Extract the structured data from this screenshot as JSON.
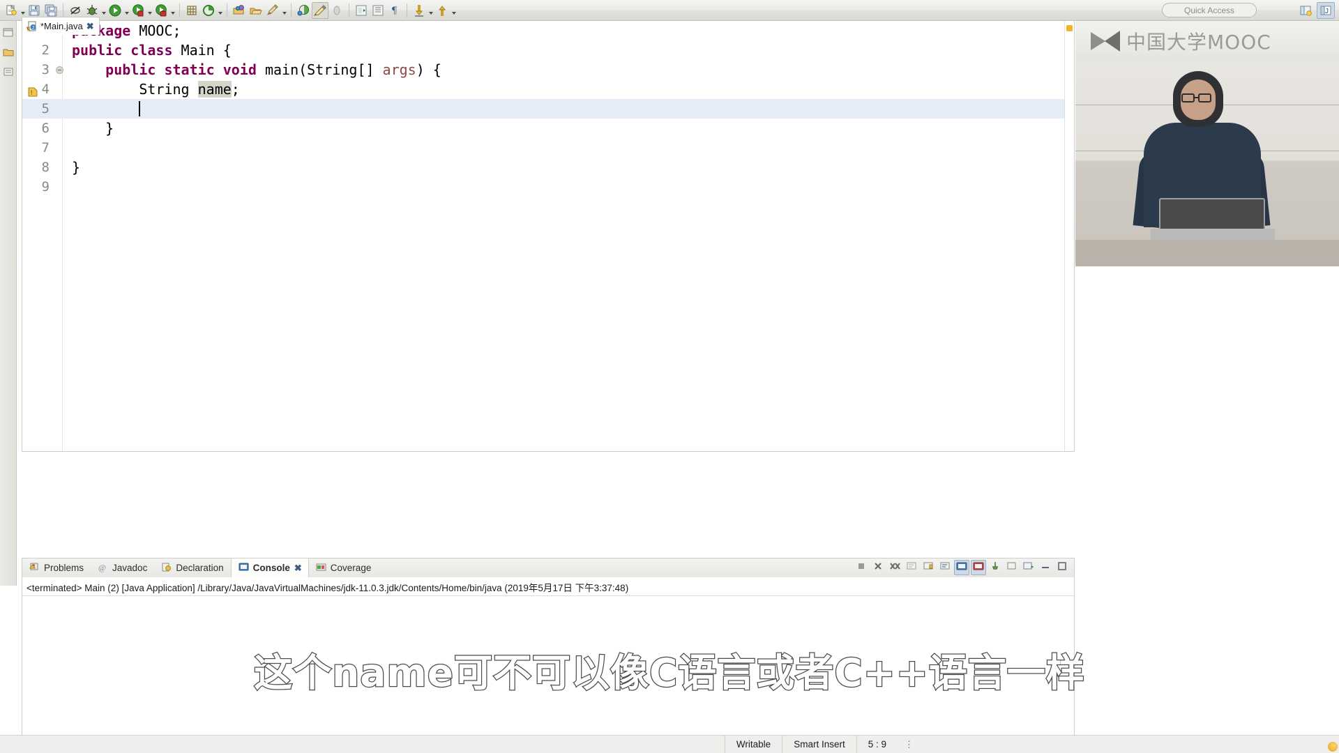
{
  "window": {
    "quick_access_label": "Quick Access"
  },
  "toolbar": {
    "buttons": [
      {
        "name": "new-wizard-button",
        "icon": "new-file-icon",
        "dropdown": true
      },
      {
        "name": "save-button",
        "icon": "save-icon",
        "dropdown": false
      },
      {
        "name": "save-all-button",
        "icon": "save-all-icon",
        "dropdown": false
      },
      {
        "name": "toggle-breakpoint-button",
        "icon": "skip-breakpoints-icon",
        "dropdown": false
      },
      {
        "name": "debug-button",
        "icon": "debug-bug-icon",
        "dropdown": true
      },
      {
        "name": "run-button",
        "icon": "run-play-icon",
        "dropdown": true
      },
      {
        "name": "coverage-button",
        "icon": "coverage-icon",
        "dropdown": true
      },
      {
        "name": "run-external-tools-button",
        "icon": "external-tools-icon",
        "dropdown": true
      },
      {
        "name": "new-java-project-button",
        "icon": "new-project-icon",
        "dropdown": false
      },
      {
        "name": "new-package-button",
        "icon": "new-package-icon",
        "dropdown": true
      },
      {
        "name": "open-type-button",
        "icon": "open-type-icon",
        "dropdown": false
      },
      {
        "name": "open-task-button",
        "icon": "open-folder-icon",
        "dropdown": false
      },
      {
        "name": "search-button",
        "icon": "pencil-search-icon",
        "dropdown": true
      },
      {
        "name": "git-button",
        "icon": "git-icon",
        "dropdown": false
      },
      {
        "name": "annotate-button",
        "icon": "highlighter-icon",
        "dropdown": false
      },
      {
        "name": "toggle-mark-button",
        "icon": "mark-occurrences-icon",
        "dropdown": false
      },
      {
        "name": "next-annotation-button",
        "icon": "next-annotation-icon",
        "dropdown": false
      },
      {
        "name": "previous-annotation-button",
        "icon": "previous-annotation-icon",
        "dropdown": false
      },
      {
        "name": "pilcrow-button",
        "icon": "pilcrow-icon",
        "dropdown": false
      },
      {
        "name": "next-edit-button",
        "icon": "down-arrow-icon",
        "dropdown": true
      },
      {
        "name": "previous-edit-button",
        "icon": "up-arrow-icon",
        "dropdown": true
      }
    ],
    "perspective_buttons": [
      {
        "name": "open-perspective-button",
        "icon": "open-perspective-icon"
      },
      {
        "name": "java-perspective-button",
        "icon": "java-perspective-icon"
      }
    ]
  },
  "editor": {
    "tab": {
      "label": "*Main.java",
      "icon": "java-file-icon",
      "close_icon": "close-icon"
    },
    "cursor_line": 5,
    "lines": [
      {
        "num": "1",
        "fold": false,
        "warn": false,
        "segments": [
          {
            "t": "package",
            "c": "kw"
          },
          {
            "t": " MOOC;",
            "c": ""
          }
        ]
      },
      {
        "num": "2",
        "fold": false,
        "warn": false,
        "segments": [
          {
            "t": "public class",
            "c": "kw"
          },
          {
            "t": " Main {",
            "c": ""
          }
        ]
      },
      {
        "num": "3",
        "fold": true,
        "warn": false,
        "segments": [
          {
            "t": "    ",
            "c": ""
          },
          {
            "t": "public static void",
            "c": "kw"
          },
          {
            "t": " main(String[] ",
            "c": ""
          },
          {
            "t": "args",
            "c": "param"
          },
          {
            "t": ") {",
            "c": ""
          }
        ]
      },
      {
        "num": "4",
        "fold": false,
        "warn": true,
        "segments": [
          {
            "t": "        String ",
            "c": ""
          },
          {
            "t": "name",
            "c": "occ"
          },
          {
            "t": ";",
            "c": ""
          }
        ]
      },
      {
        "num": "5",
        "fold": false,
        "warn": false,
        "caret": true,
        "segments": [
          {
            "t": "        ",
            "c": ""
          }
        ]
      },
      {
        "num": "6",
        "fold": false,
        "warn": false,
        "segments": [
          {
            "t": "    }",
            "c": ""
          }
        ]
      },
      {
        "num": "7",
        "fold": false,
        "warn": false,
        "segments": [
          {
            "t": "",
            "c": ""
          }
        ]
      },
      {
        "num": "8",
        "fold": false,
        "warn": false,
        "segments": [
          {
            "t": "}",
            "c": ""
          }
        ]
      },
      {
        "num": "9",
        "fold": false,
        "warn": false,
        "segments": [
          {
            "t": "",
            "c": ""
          }
        ]
      }
    ]
  },
  "video_overlay": {
    "logo_text": "中国大学MOOC",
    "logo_icon": "mooc-book-icon"
  },
  "bottom_panel": {
    "tabs": [
      {
        "label": "Problems",
        "icon": "problems-icon",
        "active": false,
        "closable": false
      },
      {
        "label": "Javadoc",
        "icon": "javadoc-icon",
        "active": false,
        "closable": false
      },
      {
        "label": "Declaration",
        "icon": "declaration-icon",
        "active": false,
        "closable": false
      },
      {
        "label": "Console",
        "icon": "console-icon",
        "active": true,
        "closable": true
      },
      {
        "label": "Coverage",
        "icon": "coverage-tab-icon",
        "active": false,
        "closable": false
      }
    ],
    "tools": [
      {
        "name": "terminate-button",
        "icon": "terminate-icon"
      },
      {
        "name": "remove-launch-button",
        "icon": "remove-launch-icon"
      },
      {
        "name": "remove-all-terminated-button",
        "icon": "remove-all-icon"
      },
      {
        "name": "clear-console-button",
        "icon": "clear-console-icon"
      },
      {
        "name": "scroll-lock-button",
        "icon": "scroll-lock-icon"
      },
      {
        "name": "word-wrap-button",
        "icon": "word-wrap-icon"
      },
      {
        "name": "show-console-on-output-button",
        "icon": "show-console-output-icon"
      },
      {
        "name": "show-console-on-error-button",
        "icon": "show-console-error-icon"
      },
      {
        "name": "pin-console-button",
        "icon": "pin-icon"
      },
      {
        "name": "display-selected-console-button",
        "icon": "display-console-icon"
      },
      {
        "name": "open-console-button",
        "icon": "open-console-icon"
      },
      {
        "name": "minimize-button",
        "icon": "minimize-icon"
      },
      {
        "name": "maximize-button",
        "icon": "maximize-icon"
      }
    ],
    "console_output": "<terminated> Main (2) [Java Application] /Library/Java/JavaVirtualMachines/jdk-11.0.3.jdk/Contents/Home/bin/java (2019年5月17日 下午3:37:48)"
  },
  "subtitle": {
    "text": "这个name可不可以像C语言或者C++语言一样"
  },
  "status_bar": {
    "writable": "Writable",
    "insert_mode": "Smart Insert",
    "position": "5 : 9",
    "overflow_icon": "vertical-dots-icon"
  },
  "colors": {
    "keyword": "#7f0055",
    "parameter": "#8a4a42",
    "occurrence_highlight": "#d4d4c8",
    "current_line": "#e3ecf7",
    "accent": "#3b5c84"
  }
}
